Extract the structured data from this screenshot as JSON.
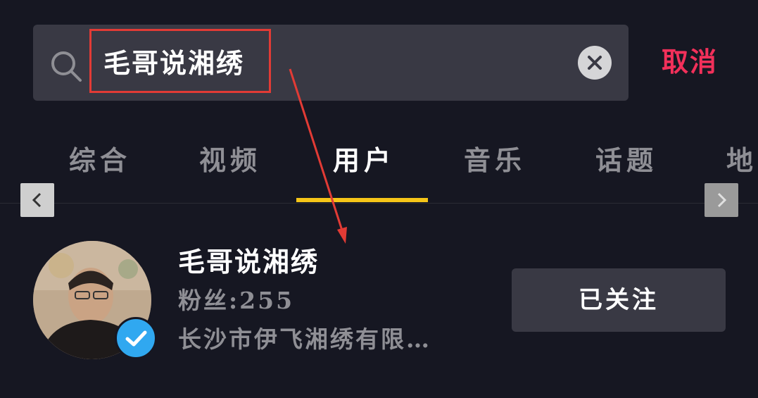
{
  "search": {
    "query": "毛哥说湘绣",
    "cancel_label": "取消",
    "icon": "search-icon",
    "clear_icon": "close-icon"
  },
  "tabs": [
    {
      "label": "综合",
      "active": false
    },
    {
      "label": "视频",
      "active": false
    },
    {
      "label": "用户",
      "active": true
    },
    {
      "label": "音乐",
      "active": false
    },
    {
      "label": "话题",
      "active": false
    },
    {
      "label": "地",
      "active": false
    }
  ],
  "scroll": {
    "left_icon": "chevron-left-icon",
    "right_icon": "chevron-right-icon"
  },
  "result": {
    "name": "毛哥说湘绣",
    "fans": "粉丝:255",
    "description": "长沙市伊飞湘绣有限…",
    "follow_label": "已关注",
    "verified_icon": "verified-check-icon"
  },
  "colors": {
    "background": "#161722",
    "search_bg": "#393944",
    "cancel": "#f2305a",
    "tab_underline": "#f5c518",
    "highlight_box": "#e23b35",
    "verified": "#30a8f0"
  }
}
